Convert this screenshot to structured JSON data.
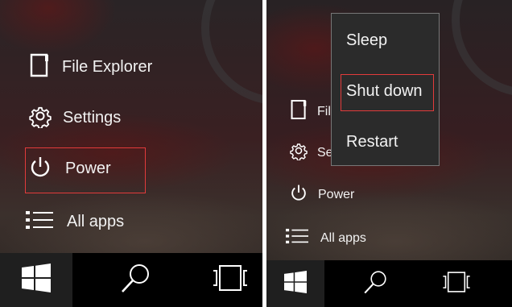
{
  "left_panel": {
    "menu": {
      "file_explorer": "File Explorer",
      "settings": "Settings",
      "power": "Power",
      "all_apps": "All apps"
    }
  },
  "right_panel": {
    "menu": {
      "file_explorer": "File Explorer",
      "settings": "Settings",
      "power": "Power",
      "all_apps": "All apps"
    },
    "power_flyout": {
      "sleep": "Sleep",
      "shut_down": "Shut down",
      "restart": "Restart"
    }
  },
  "taskbar": {
    "icons": [
      "windows-start-icon",
      "search-icon",
      "task-view-icon"
    ]
  },
  "colors": {
    "highlight": "#e23b3b",
    "flyout_bg": "#2b2b2b",
    "taskbar_bg": "#000000",
    "start_button_bg": "#1f1f1f"
  }
}
